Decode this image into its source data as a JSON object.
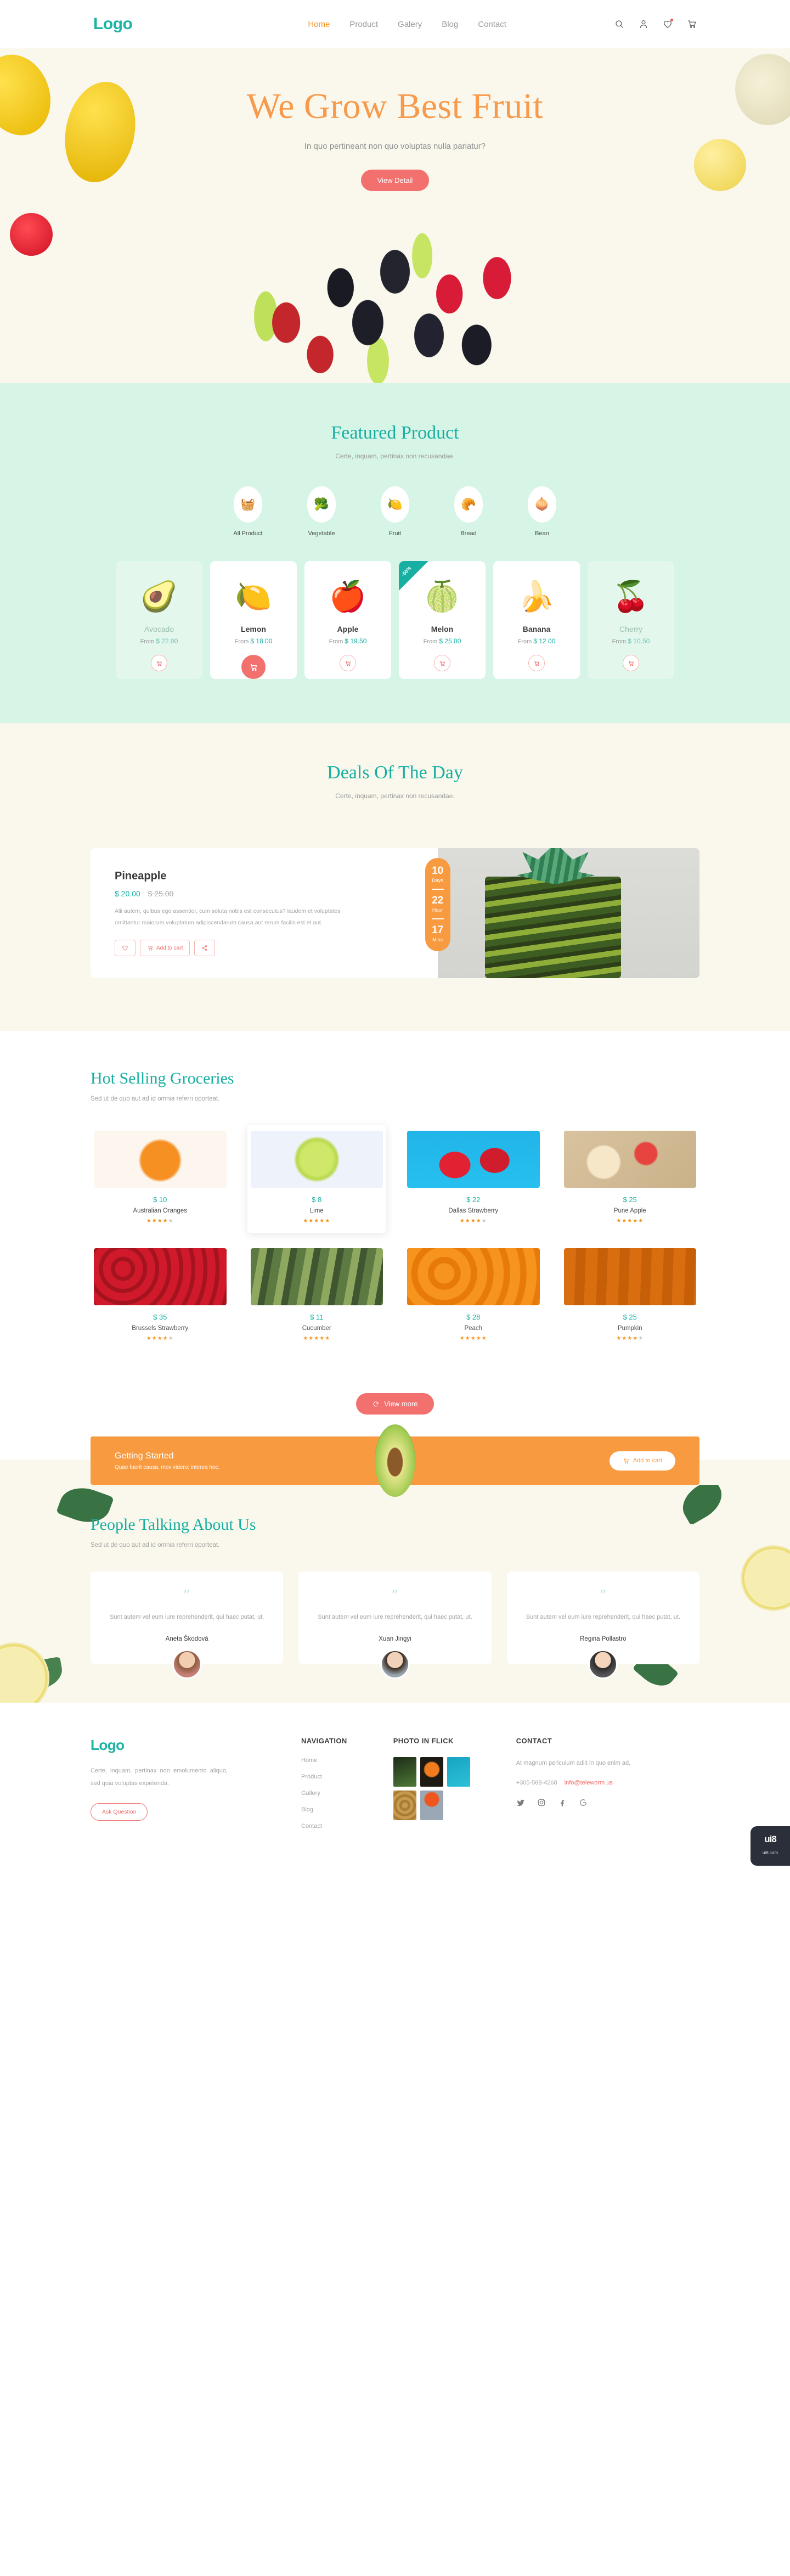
{
  "header": {
    "logo": "Logo",
    "nav": [
      {
        "label": "Home",
        "active": true
      },
      {
        "label": "Product",
        "active": false
      },
      {
        "label": "Galery",
        "active": false
      },
      {
        "label": "Blog",
        "active": false
      },
      {
        "label": "Contact",
        "active": false
      }
    ],
    "icons": [
      "search-icon",
      "user-icon",
      "heart-icon",
      "cart-icon"
    ]
  },
  "hero": {
    "title": "We Grow Best Fruit",
    "subtitle": "In quo pertineant non quo voluptas nulla pariatur?",
    "cta": "View Detail"
  },
  "featured": {
    "title": "Featured Product",
    "subtitle": "Certe, inquam, pertinax non recusandae.",
    "categories": [
      {
        "label": "All Product",
        "icon": "🧺"
      },
      {
        "label": "Vegetable",
        "icon": "🥦"
      },
      {
        "label": "Fruit",
        "icon": "🍋"
      },
      {
        "label": "Bread",
        "icon": "🥐"
      },
      {
        "label": "Bean",
        "icon": "🧅"
      }
    ],
    "price_prefix": "From",
    "products": [
      {
        "name": "Avocado",
        "price": "$ 22.00",
        "icon": "🥑",
        "dim": true,
        "badge": "",
        "cart_filled": false
      },
      {
        "name": "Lemon",
        "price": "$ 18.00",
        "icon": "🍋",
        "dim": false,
        "badge": "",
        "cart_filled": true
      },
      {
        "name": "Apple",
        "price": "$ 19.50",
        "icon": "🍎",
        "dim": false,
        "badge": "",
        "cart_filled": false
      },
      {
        "name": "Melon",
        "price": "$ 25.00",
        "icon": "🍈",
        "dim": false,
        "badge": "-50%",
        "cart_filled": false
      },
      {
        "name": "Banana",
        "price": "$ 12.00",
        "icon": "🍌",
        "dim": false,
        "badge": "",
        "cart_filled": false
      },
      {
        "name": "Cherry",
        "price": "$ 10.50",
        "icon": "🍒",
        "dim": true,
        "badge": "",
        "cart_filled": false
      }
    ]
  },
  "deals": {
    "title": "Deals Of The Day",
    "subtitle": "Certe, inquam, pertinax non recusandae.",
    "product_name": "Pineapple",
    "price_now": "$ 20.00",
    "price_was": "$ 25.00",
    "description": "Alii autem, quibus ego assentior, cum soluta nobis est consecutus? laudem et voluptates omittantur maiorum voluptatum adipiscendarum causa aut rerum facilis est et aut.",
    "add_to_cart": "Add to cart",
    "countdown": [
      {
        "value": "10",
        "unit": "Days"
      },
      {
        "value": "22",
        "unit": "Hour"
      },
      {
        "value": "17",
        "unit": "Mins"
      }
    ]
  },
  "hot": {
    "title": "Hot Selling Groceries",
    "subtitle": "Sed ut de quo aut ad id omnia referri oporteat.",
    "view_more": "View more",
    "items": [
      {
        "price": "$ 10",
        "name": "Australian Oranges",
        "rating": 4,
        "highlight": false,
        "thumb": "oranges"
      },
      {
        "price": "$ 8",
        "name": "Lime",
        "rating": 5,
        "highlight": true,
        "thumb": "lime"
      },
      {
        "price": "$ 22",
        "name": "Dallas Strawberry",
        "rating": 4,
        "highlight": false,
        "thumb": "strawberry-blue"
      },
      {
        "price": "$ 25",
        "name": "Pune Apple",
        "rating": 5,
        "highlight": false,
        "thumb": "apple-slices"
      },
      {
        "price": "$ 35",
        "name": "Brussels Strawberry",
        "rating": 4,
        "highlight": false,
        "thumb": "strawberries"
      },
      {
        "price": "$ 11",
        "name": "Cucumber",
        "rating": 5,
        "highlight": false,
        "thumb": "cucumber"
      },
      {
        "price": "$ 28",
        "name": "Peach",
        "rating": 5,
        "highlight": false,
        "thumb": "peach"
      },
      {
        "price": "$ 25",
        "name": "Pumpkin",
        "rating": 4,
        "highlight": false,
        "thumb": "pumpkin"
      }
    ]
  },
  "getting_started": {
    "title": "Getting Started",
    "subtitle": "Quae fuerit causa, mox videro; interea hoc.",
    "cta": "Add to cart"
  },
  "testimonials": {
    "title": "People Talking About Us",
    "subtitle": "Sed ut de quo aut ad id omnia referri oporteat.",
    "quote_mark": "″",
    "items": [
      {
        "quote": "Sunt autem vel eum iure reprehenderit, qui haec putat, ut.",
        "name": "Aneta Škodová"
      },
      {
        "quote": "Sunt autem vel eum iure reprehenderit, qui haec putat, ut.",
        "name": "Xuan Jingyi"
      },
      {
        "quote": "Sunt autem vel eum iure reprehenderit, qui haec putat, ut.",
        "name": "Regina Pollastro"
      }
    ]
  },
  "footer": {
    "logo": "Logo",
    "about": "Certe, inquam, pertinax non emolumento aliquo, sed quia voluptas expetenda.",
    "ask_button": "Ask Question",
    "navigation_title": "NAVIGATION",
    "navigation": [
      "Home",
      "Product",
      "Gallery",
      "Blog",
      "Contact"
    ],
    "photo_title": "PHOTO IN FLICK",
    "contact_title": "CONTACT",
    "contact_text": "At magnum periculum adiit in quo enim ad.",
    "phone": "+305-588-4268",
    "email": "info@teleworm.us",
    "socials": [
      "twitter-icon",
      "instagram-icon",
      "facebook-icon",
      "google-icon"
    ]
  },
  "watermark": {
    "mark": "ui8",
    "site": "ui8.com"
  }
}
